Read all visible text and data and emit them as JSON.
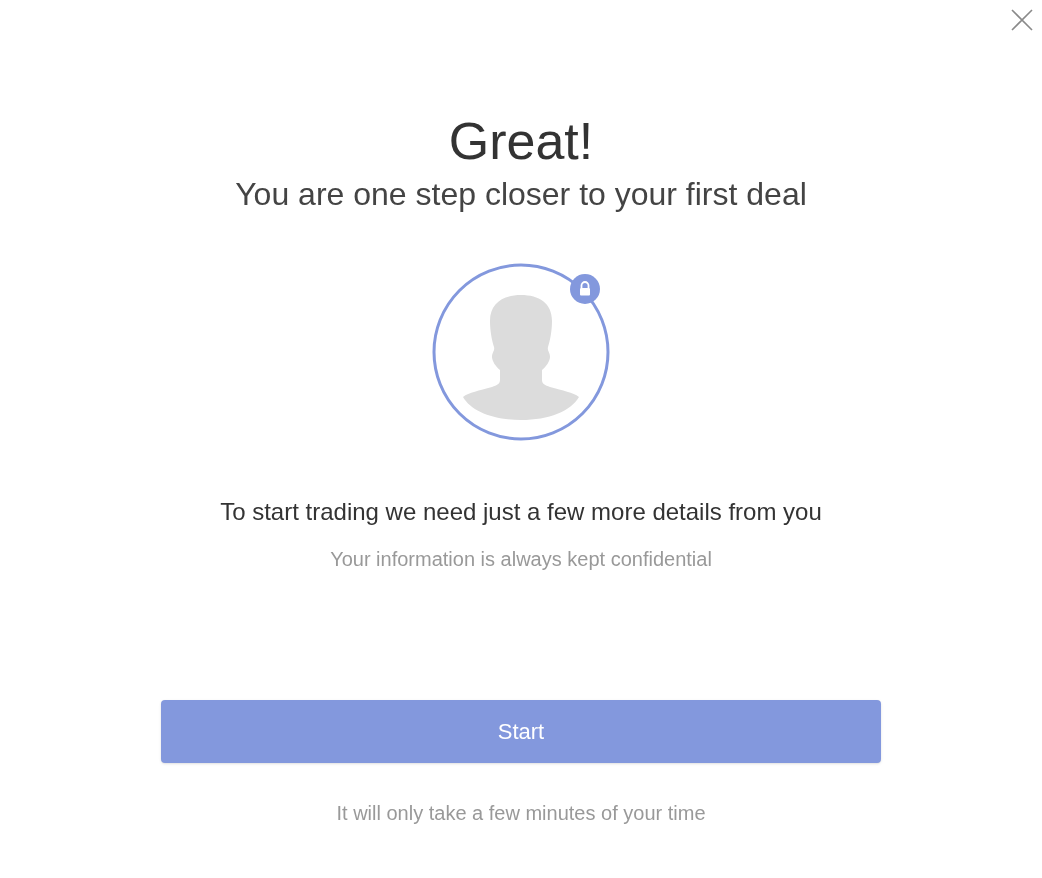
{
  "dialog": {
    "title": "Great!",
    "subtitle": "You are one step closer to your first deal",
    "message": "To start trading we need just a few more details from you",
    "note": "Your information is always kept confidential",
    "button": "Start",
    "footer": "It will only take a few minutes of your time"
  }
}
